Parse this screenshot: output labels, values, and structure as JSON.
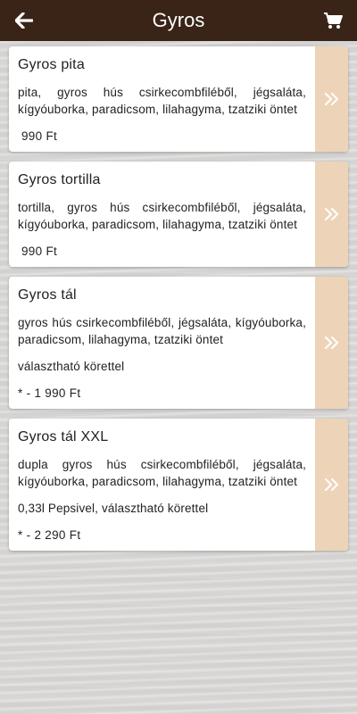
{
  "header": {
    "title": "Gyros",
    "back_icon": "arrow-left-icon",
    "cart_icon": "shopping-cart-icon",
    "background": "#3a2418"
  },
  "accent": "#edd4b8",
  "items": [
    {
      "title": "Gyros pita",
      "description": "pita, gyros hús csirkecombfiléből, jégsaláta, kígyóuborka, paradicsom, lilahagyma, tzatziki öntet",
      "extra": "",
      "price": "990 Ft"
    },
    {
      "title": "Gyros tortilla",
      "description": "tortilla, gyros hús csirkecombfiléből, jégsaláta, kígyóuborka, paradicsom, lilahagyma, tzatziki öntet",
      "extra": "",
      "price": "990 Ft"
    },
    {
      "title": "Gyros tál",
      "description": "gyros hús csirkecombfiléből, jégsaláta, kígyóuborka, paradicsom, lilahagyma, tzatziki öntet",
      "extra": "választható körettel",
      "price": "* - 1 990 Ft"
    },
    {
      "title": "Gyros tál XXL",
      "description": "dupla gyros hús csirkecombfiléből, jégsaláta, kígyóuborka, paradicsom, lilahagyma, tzatziki öntet",
      "extra": "0,33l Pepsivel, választható körettel",
      "price": "* - 2 290 Ft"
    }
  ]
}
